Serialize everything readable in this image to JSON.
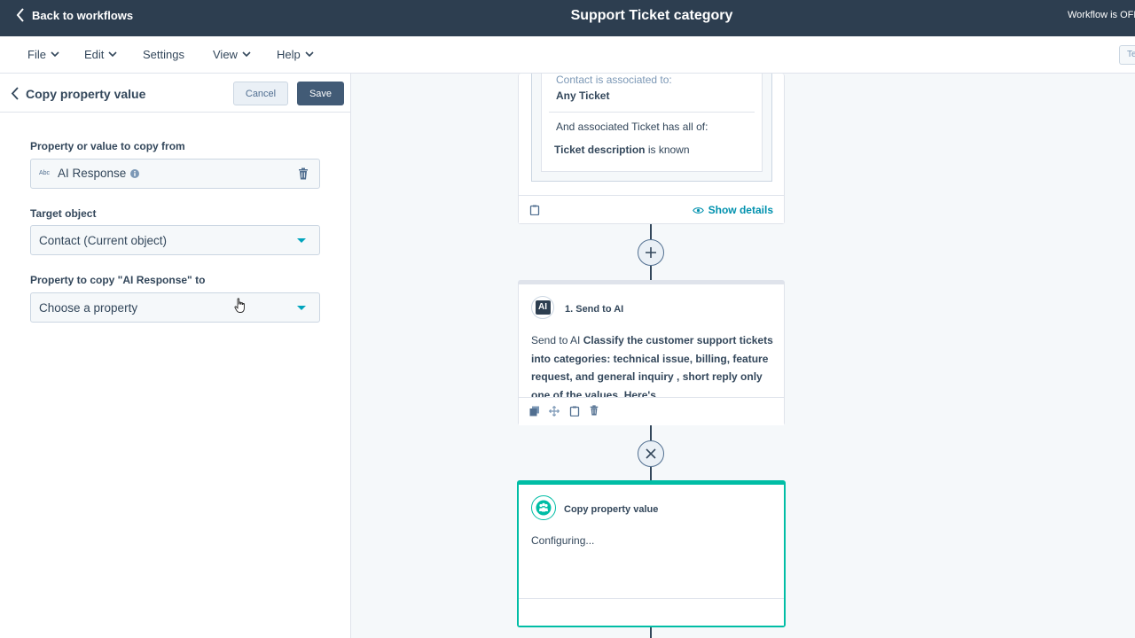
{
  "topbar": {
    "back_label": "Back to workflows",
    "title": "Support Ticket category",
    "status": "Workflow is OFF"
  },
  "menu": {
    "items": [
      {
        "label": "File"
      },
      {
        "label": "Edit"
      },
      {
        "label": "Settings"
      },
      {
        "label": "View"
      },
      {
        "label": "Help"
      }
    ],
    "right_button": "Te"
  },
  "panel": {
    "title": "Copy property value",
    "cancel_label": "Cancel",
    "save_label": "Save",
    "source_label": "Property or value to copy from",
    "source_type_badge": "Abc",
    "source_value": "AI Response",
    "target_label": "Target object",
    "target_value": "Contact (Current object)",
    "dest_label": "Property to copy \"AI Response\" to",
    "dest_placeholder": "Choose a property"
  },
  "canvas": {
    "trigger": {
      "line1": "Contact is associated to:",
      "line2": "Any Ticket",
      "line3": "And associated Ticket has all of:",
      "line4_bold": "Ticket description",
      "line4_rest": " is known",
      "show_details": "Show details"
    },
    "ai_step": {
      "title": "1. Send to AI",
      "icon_text": "AI",
      "body_prefix": "Send to AI ",
      "body_bold": "Classify the customer support tickets into categories: technical issue, billing, feature request, and general inquiry , short reply only one of the values. Here's"
    },
    "copy_step": {
      "title": "Copy property value",
      "body": "Configuring..."
    }
  },
  "colors": {
    "topbar": "#2d3e50",
    "accent_teal": "#00bda5",
    "dropdown_caret": "#00a4bd",
    "save_button": "#425b76"
  }
}
